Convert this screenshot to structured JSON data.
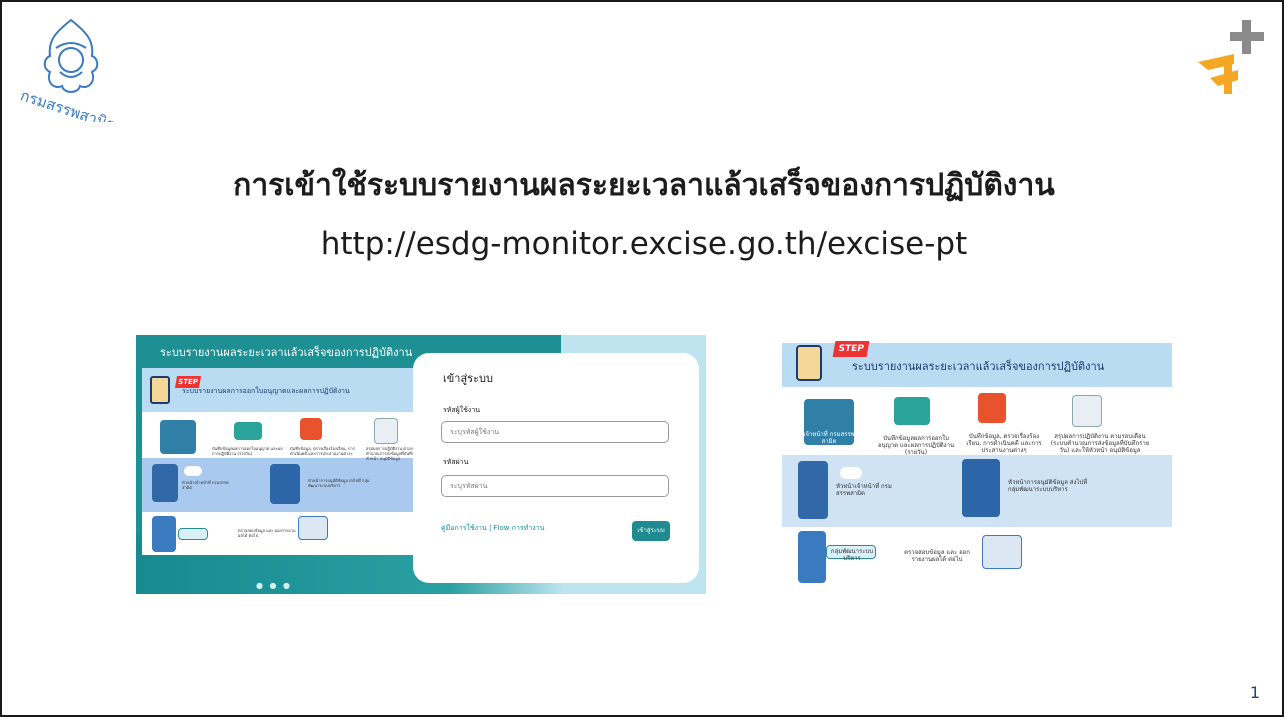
{
  "slide": {
    "seal_text": "กรมสรรพสามิต",
    "title": "การเข้าใช้ระบบรายงานผลระยะเวลาแล้วเสร็จของการปฏิบัติงาน",
    "url": "http://esdg-monitor.excise.go.th/excise-pt",
    "page_number": "1"
  },
  "login_screenshot": {
    "header": "ระบบรายงานผลระยะเวลาแล้วเสร็จของการปฏิบัติงาน",
    "card_title": "ระบบรายงานผลการออกใบอนุญาตและผลการปฏิบัติงาน",
    "step_label": "STEP",
    "login_title": "เข้าสู่ระบบ",
    "username_label": "รหัสผู้ใช้งาน",
    "username_placeholder": "ระบุรหัสผู้ใช้งาน",
    "password_label": "รหัสผ่าน",
    "password_placeholder": "ระบุรหัสผ่าน",
    "help_link": "คู่มือการใช้งาน | Flow การทำงาน",
    "login_button": "เข้าสู่ระบบ",
    "carousel_dots": "● ● ●"
  },
  "info_screenshot": {
    "step_label": "STEP",
    "title": "ระบบรายงานผลระยะเวลาแล้วเสร็จของการปฏิบัติงาน",
    "steps": [
      "เจ้าหน้าที่ กรมสรรพสามิต",
      "บันทึกข้อมูลผลการออกใบอนุญาต และผลการปฏิบัติงาน (รายวัน)",
      "บันทึกข้อมูล, ตรวจเรื่องร้องเรียน, การดำเนินคดี และการประสานงานต่างๆ",
      "สรุปผลการปฏิบัติงาน ตามรอบเดือน (ระบบคำนวณการส่งข้อมูลที่บันทึกรายวัน) และให้หัวหน้า อนุมัติข้อมูล",
      "หัวหน้าเจ้าหน้าที่ กรมสรรพสามิต",
      "หัวหน้าการอนุมัติข้อมูล ส่งไปที่ กลุ่มพัฒนาระบบบริหาร",
      "กลุ่มพัฒนาระบบบริหาร",
      "ตรวจสอบข้อมูล และ ออกรายงานผลได้ ต่อไป"
    ]
  },
  "colors": {
    "teal": "#1e8f93",
    "light_blue": "#b9dcf2",
    "step_red": "#e33333",
    "title_text": "#1c1c1c",
    "page_number": "#1f3f99",
    "logo_gray": "#8a8a8a",
    "logo_orange": "#f5a623"
  }
}
